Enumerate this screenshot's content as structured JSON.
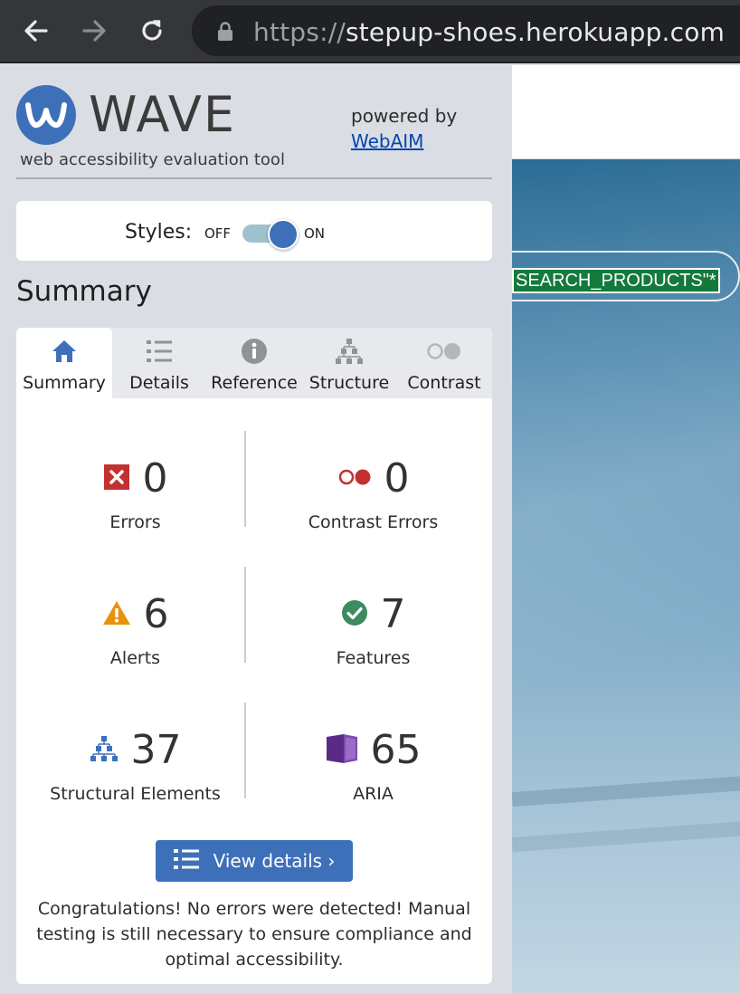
{
  "browser": {
    "url_scheme": "https://",
    "url_host": "stepup-shoes.herokuapp.com"
  },
  "wave": {
    "logo_text": "WAVE",
    "logo_subtitle": "web accessibility evaluation tool",
    "powered_by": "powered by",
    "powered_link": "WebAIM",
    "styles_label": "Styles:",
    "toggle_off": "OFF",
    "toggle_on": "ON",
    "toggle_state": "on",
    "section_title": "Summary",
    "tabs": [
      {
        "label": "Summary",
        "icon": "home-icon",
        "active": true
      },
      {
        "label": "Details",
        "icon": "list-icon",
        "active": false
      },
      {
        "label": "Reference",
        "icon": "info-icon",
        "active": false
      },
      {
        "label": "Structure",
        "icon": "hierarchy-icon",
        "active": false
      },
      {
        "label": "Contrast",
        "icon": "contrast-icon",
        "active": false
      }
    ],
    "stats": {
      "errors": {
        "count": "0",
        "label": "Errors",
        "icon": "error-x-icon"
      },
      "contrast_errors": {
        "count": "0",
        "label": "Contrast Errors",
        "icon": "contrast-error-icon"
      },
      "alerts": {
        "count": "6",
        "label": "Alerts",
        "icon": "alert-triangle-icon"
      },
      "features": {
        "count": "7",
        "label": "Features",
        "icon": "feature-check-icon"
      },
      "structural": {
        "count": "37",
        "label": "Structural Elements",
        "icon": "structure-icon"
      },
      "aria": {
        "count": "65",
        "label": "ARIA",
        "icon": "aria-icon"
      }
    },
    "view_details": "View details ›",
    "congrats": "Congratulations! No errors were detected! Manual testing is still necessary to ensure compliance and optimal accessibility."
  },
  "page": {
    "search_tag": "SEARCH_PRODUCTS\"*"
  },
  "colors": {
    "wave_blue": "#3e70ba",
    "error_red": "#c23030",
    "alert_orange": "#e8920e",
    "feature_green": "#3d8b5e",
    "aria_purple": "#5b2a86"
  }
}
